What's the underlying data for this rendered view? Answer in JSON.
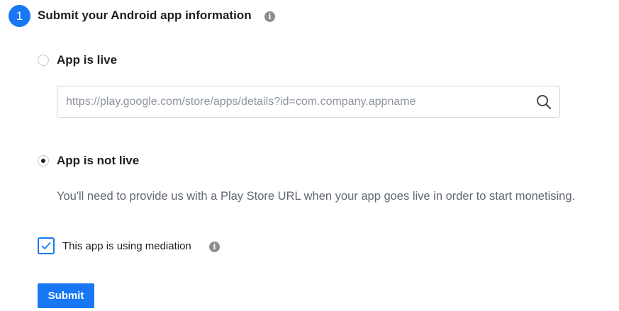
{
  "step": {
    "number": "1",
    "title": "Submit your Android app information",
    "info_icon": "info-icon"
  },
  "options": {
    "live": {
      "label": "App is live",
      "selected": false
    },
    "not_live": {
      "label": "App is not live",
      "selected": true
    }
  },
  "url_field": {
    "placeholder": "https://play.google.com/store/apps/details?id=com.company.appname",
    "value": "",
    "icon": "search-icon"
  },
  "helper_text": "You'll need to provide us with a Play Store URL when your app goes live in order to start monetising.",
  "mediation": {
    "label": "This app is using mediation",
    "checked": true,
    "info_icon": "info-icon"
  },
  "submit": {
    "label": "Submit"
  },
  "colors": {
    "accent": "#1877f2",
    "text": "#1c1e21",
    "secondary_text": "#606770",
    "icon_gray": "#8a8d91"
  }
}
